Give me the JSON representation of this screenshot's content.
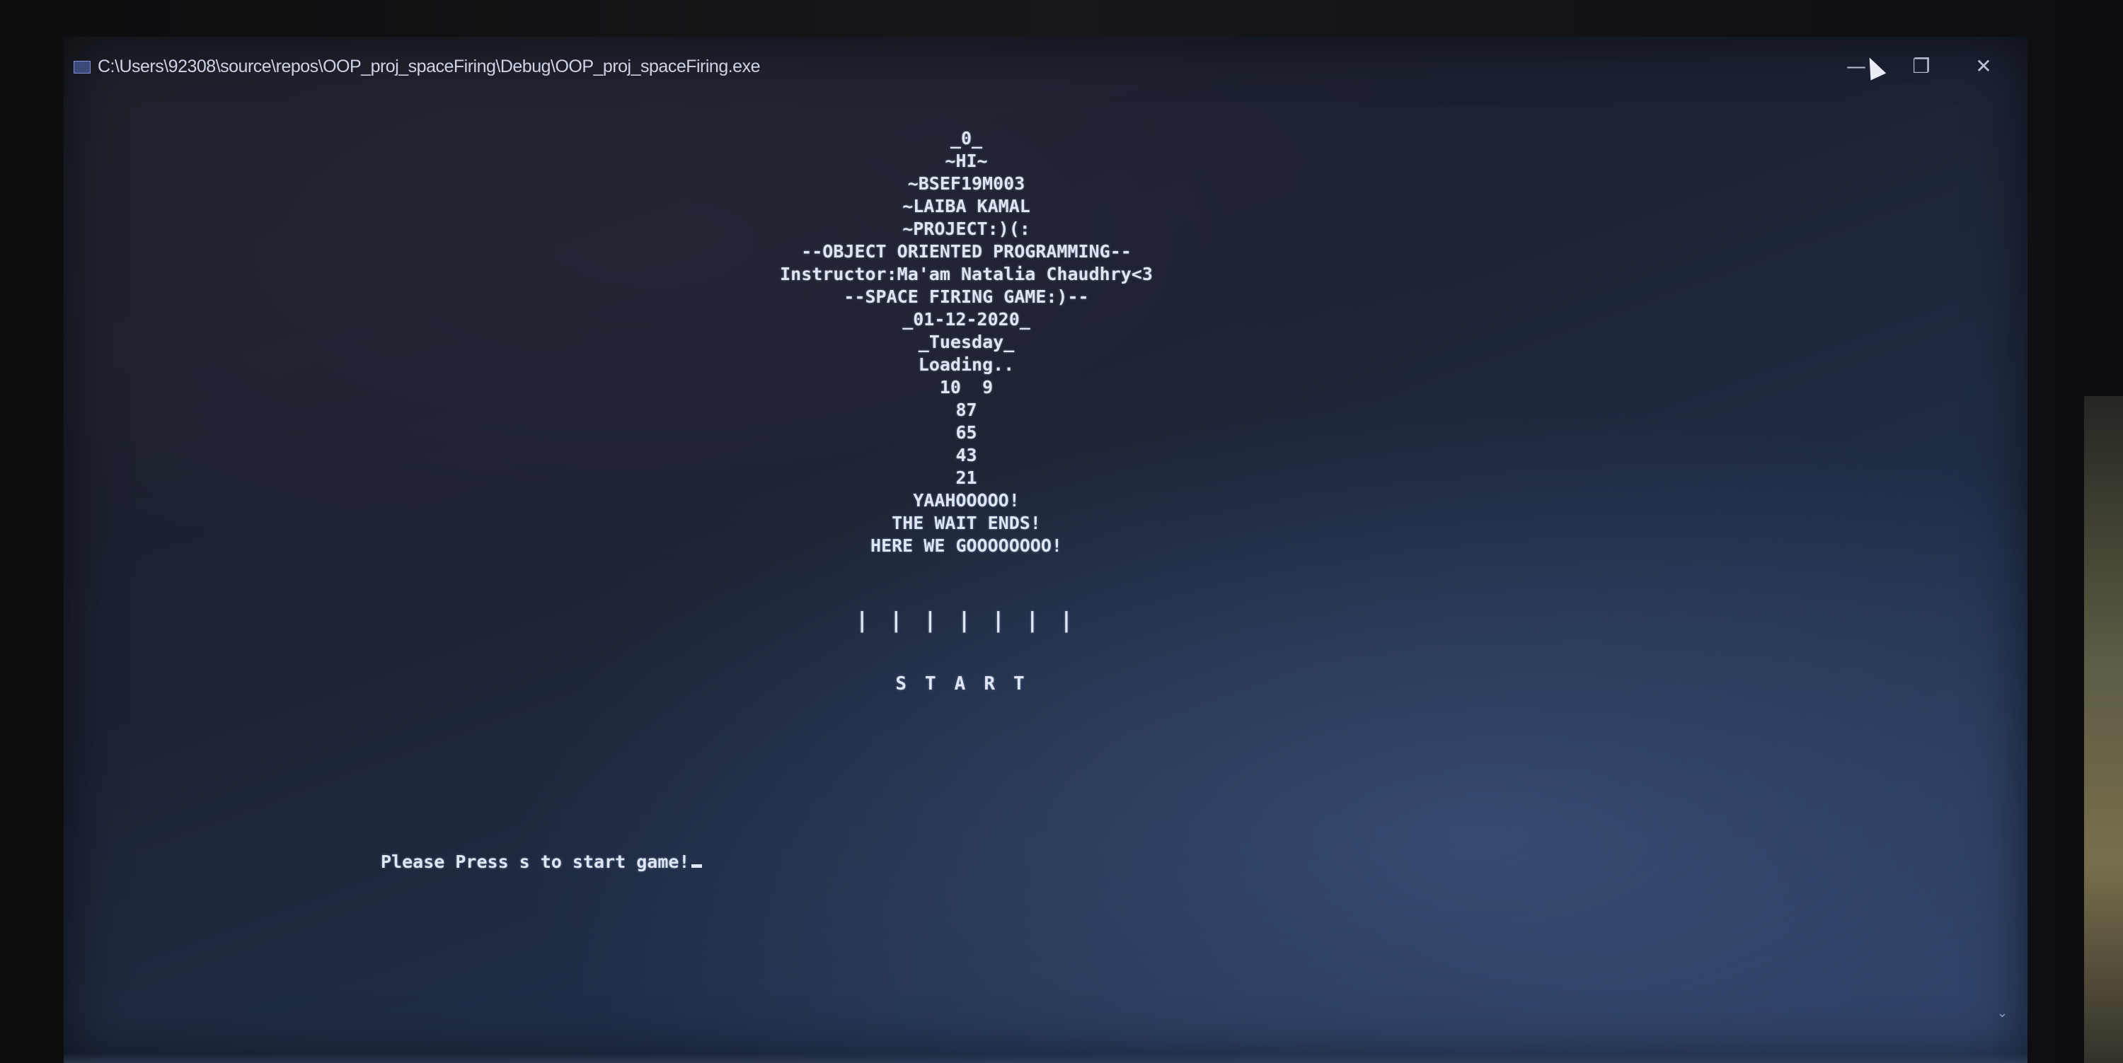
{
  "window": {
    "title": "C:\\Users\\92308\\source\\repos\\OOP_proj_spaceFiring\\Debug\\OOP_proj_spaceFiring.exe",
    "minimize_glyph": "—",
    "maximize_glyph": "❐",
    "close_glyph": "✕"
  },
  "console": {
    "banner_lines": [
      "_0_",
      "~HI~",
      "~BSEF19M003",
      "~LAIBA KAMAL",
      "~PROJECT:)(:",
      "--OBJECT ORIENTED PROGRAMMING--",
      "Instructor:Ma'am Natalia Chaudhry<3",
      "--SPACE FIRING GAME:)--",
      "_01-12-2020_",
      "_Tuesday_",
      "Loading..",
      "10  9",
      "87",
      "65",
      "43",
      "21",
      "YAAHOOOOO!",
      "THE WAIT ENDS!",
      "HERE WE GOOOOOOOO!"
    ],
    "bars": "| | | | | | |",
    "start": "START",
    "prompt": "Please Press s to start game!"
  },
  "colors": {
    "console_text": "#dfe6f3",
    "screen_bg": "#1c2232"
  }
}
